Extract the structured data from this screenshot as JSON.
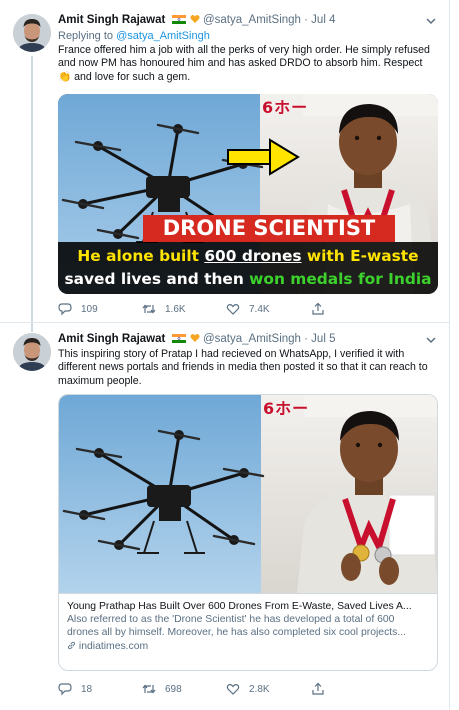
{
  "colors": {
    "accent": "#1b95e0",
    "muted": "#5b7083",
    "text": "#0f1419",
    "banner_red": "#d62a20",
    "banner_yellow": "#ffe400",
    "banner_green": "#3cd12c"
  },
  "tweets": [
    {
      "author": "Amit Singh Rajawat",
      "handle": "@satya_AmitSingh",
      "time": "· Jul 4",
      "reply_prefix": "Replying to",
      "reply_handle": "@satya_AmitSingh",
      "text": "France offered him a job with all the perks of very high order. He simply refused and now PM has honoured him and has asked DRDO to absorb him. Respect 👏 and love for such a gem.",
      "image_banner": {
        "red_label": "DRONE SCIENTIST",
        "line1_pre": "He alone built ",
        "line1_highlight": "600 drones",
        "line1_post": " with E-waste",
        "line2_pre": "saved lives and then ",
        "line2_highlight": "won medals for India",
        "bg_sign": "6ホー"
      },
      "actions": {
        "replies": "109",
        "retweets": "1.6K",
        "likes": "7.4K"
      }
    },
    {
      "author": "Amit Singh Rajawat",
      "handle": "@satya_AmitSingh",
      "time": "· Jul 5",
      "text": "This inspiring story of Pratap I had recieved on WhatsApp, I verified it with different news portals and friends in media then posted it so that it can reach to maximum people.",
      "card": {
        "bg_sign": "6ホー",
        "title": "Young Prathap Has Built Over 600 Drones From E-Waste, Saved Lives A...",
        "description": "Also referred to as the 'Drone Scientist' he has developed a total of 600 drones all by himself. Moreover, he has also completed six cool projects...",
        "domain": "indiatimes.com"
      },
      "actions": {
        "replies": "18",
        "retweets": "698",
        "likes": "2.8K"
      }
    }
  ],
  "icons": [
    "avatar",
    "flag-india-icon",
    "orange-heart-icon",
    "chevron-down-icon",
    "reply-icon",
    "retweet-icon",
    "like-icon",
    "share-icon",
    "link-icon",
    "drone-image",
    "student-with-medals-image"
  ]
}
